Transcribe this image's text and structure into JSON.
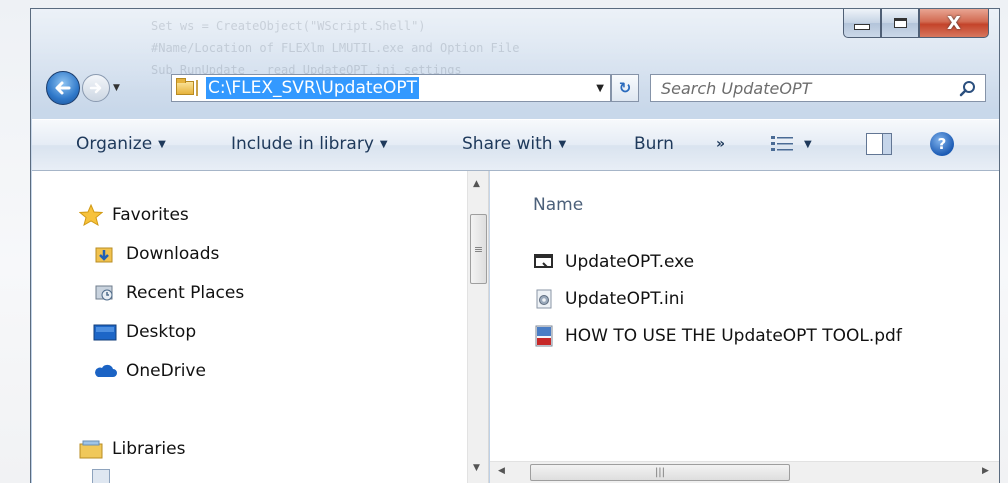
{
  "window": {
    "background_lines": [
      "Set ws = CreateObject(\"WScript.Shell\")",
      "#Name/Location of FLEXlm LMUTIL.exe and Option File",
      "Sub RunUpdate - read UpdateOPT.ini settings"
    ],
    "close_glyph": "X"
  },
  "navbar": {
    "address": "C:\\FLEX_SVR\\UpdateOPT",
    "search_placeholder": "Search UpdateOPT",
    "refresh_glyph": "↻",
    "dropdown_glyph": "▼"
  },
  "toolbar": {
    "organize": "Organize",
    "include": "Include in library",
    "share": "Share with",
    "burn": "Burn",
    "more": "»",
    "help": "?"
  },
  "nav_pane": {
    "favorites": "Favorites",
    "items": [
      {
        "label": "Downloads",
        "icon": "downloads-folder-icon"
      },
      {
        "label": "Recent Places",
        "icon": "recent-places-icon"
      },
      {
        "label": "Desktop",
        "icon": "desktop-icon"
      },
      {
        "label": "OneDrive",
        "icon": "onedrive-icon"
      }
    ],
    "libraries": "Libraries"
  },
  "files": {
    "column_header": "Name",
    "items": [
      {
        "name": "UpdateOPT.exe",
        "icon": "exe-icon"
      },
      {
        "name": "UpdateOPT.ini",
        "icon": "ini-settings-icon"
      },
      {
        "name": "HOW TO USE THE UpdateOPT TOOL.pdf",
        "icon": "pdf-icon"
      }
    ]
  },
  "colors": {
    "selection": "#3399ff",
    "toolbar_text": "#1e395b",
    "column_header": "#4c607a"
  }
}
